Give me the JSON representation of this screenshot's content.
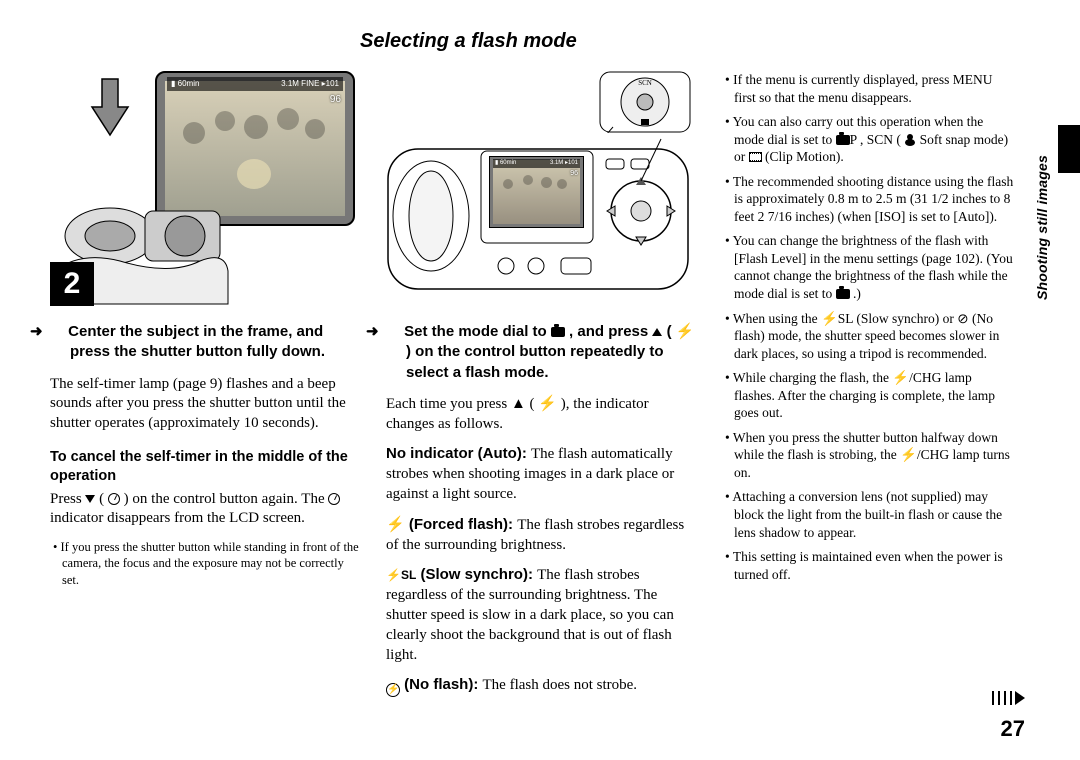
{
  "heading": "Selecting a flash mode",
  "side_label": "Shooting still images",
  "page_number": "27",
  "fig1": {
    "step_number": "2",
    "overlay_left": "▮ 60min",
    "overlay_right": "3.1M FINE ▸101",
    "overlay_count": "96"
  },
  "fig2": {
    "overlay_left": "▮ 60min",
    "overlay_right": "3.1M  ▸101",
    "overlay_count": "96"
  },
  "col1": {
    "instruction": "Center the subject in the frame, and press the shutter button fully down.",
    "body": "The self-timer lamp (page 9) flashes and a beep sounds after you press the shutter button until the shutter operates (approximately 10 seconds).",
    "sub_heading": "To cancel the self-timer in the middle of the operation",
    "cancel_1": "Press ",
    "cancel_2": " ( ",
    "cancel_3": " ) on the control button again. The ",
    "cancel_4": " indicator disappears from the LCD screen.",
    "note": "If you press the shutter button while standing in front of the camera, the focus and the exposure may not be correctly set."
  },
  "col2": {
    "instruction_1": "Set the mode dial to ",
    "instruction_2": " , and press ",
    "instruction_3": " ( ",
    "instruction_4": " ) on the control button repeatedly to select a flash mode.",
    "body": "Each time you press ▲ ( ⚡ ), the indicator changes as follows.",
    "auto_label": "No indicator (Auto): ",
    "auto_body": "The flash automatically strobes when shooting images in a dark place or against a light source.",
    "forced_label": " (Forced flash): ",
    "forced_body": "The flash strobes regardless of the surrounding brightness.",
    "slow_label": " (Slow synchro): ",
    "slow_body": "The flash strobes regardless of the surrounding brightness. The shutter speed is slow in a dark place, so you can clearly shoot the background that is out of flash light.",
    "noflash_label": " (No flash): ",
    "noflash_body": "The flash does not strobe."
  },
  "col3": {
    "b1": "If the menu is currently displayed, press MENU first so that the menu disappears.",
    "b2a": "You can also carry out this operation when the mode dial is set to ",
    "b2b": "P , SCN ( ",
    "b2c": " Soft snap mode) or ",
    "b2d": " (Clip Motion).",
    "b3": "The recommended shooting distance using the flash is approximately 0.8 m to 2.5 m (31 1/2 inches to 8 feet 2 7/16 inches) (when [ISO] is set to [Auto]).",
    "b4a": "You can change the brightness of the flash with [Flash Level] in the menu settings (page 102). (You cannot change the brightness of the flash while the mode dial is set to ",
    "b4b": " .)",
    "b5": "When using the ⚡SL (Slow synchro) or ⊘ (No flash) mode, the shutter speed becomes slower in dark places, so using a tripod is recommended.",
    "b6": "While charging the flash, the ⚡/CHG lamp flashes. After the charging is complete, the lamp goes out.",
    "b7": "When you press the shutter button halfway down while the flash is strobing, the ⚡/CHG lamp turns on.",
    "b8": "Attaching a conversion lens (not supplied) may block the light from the built-in flash or cause the lens shadow to appear.",
    "b9": "This setting is maintained even when the power is turned off."
  }
}
